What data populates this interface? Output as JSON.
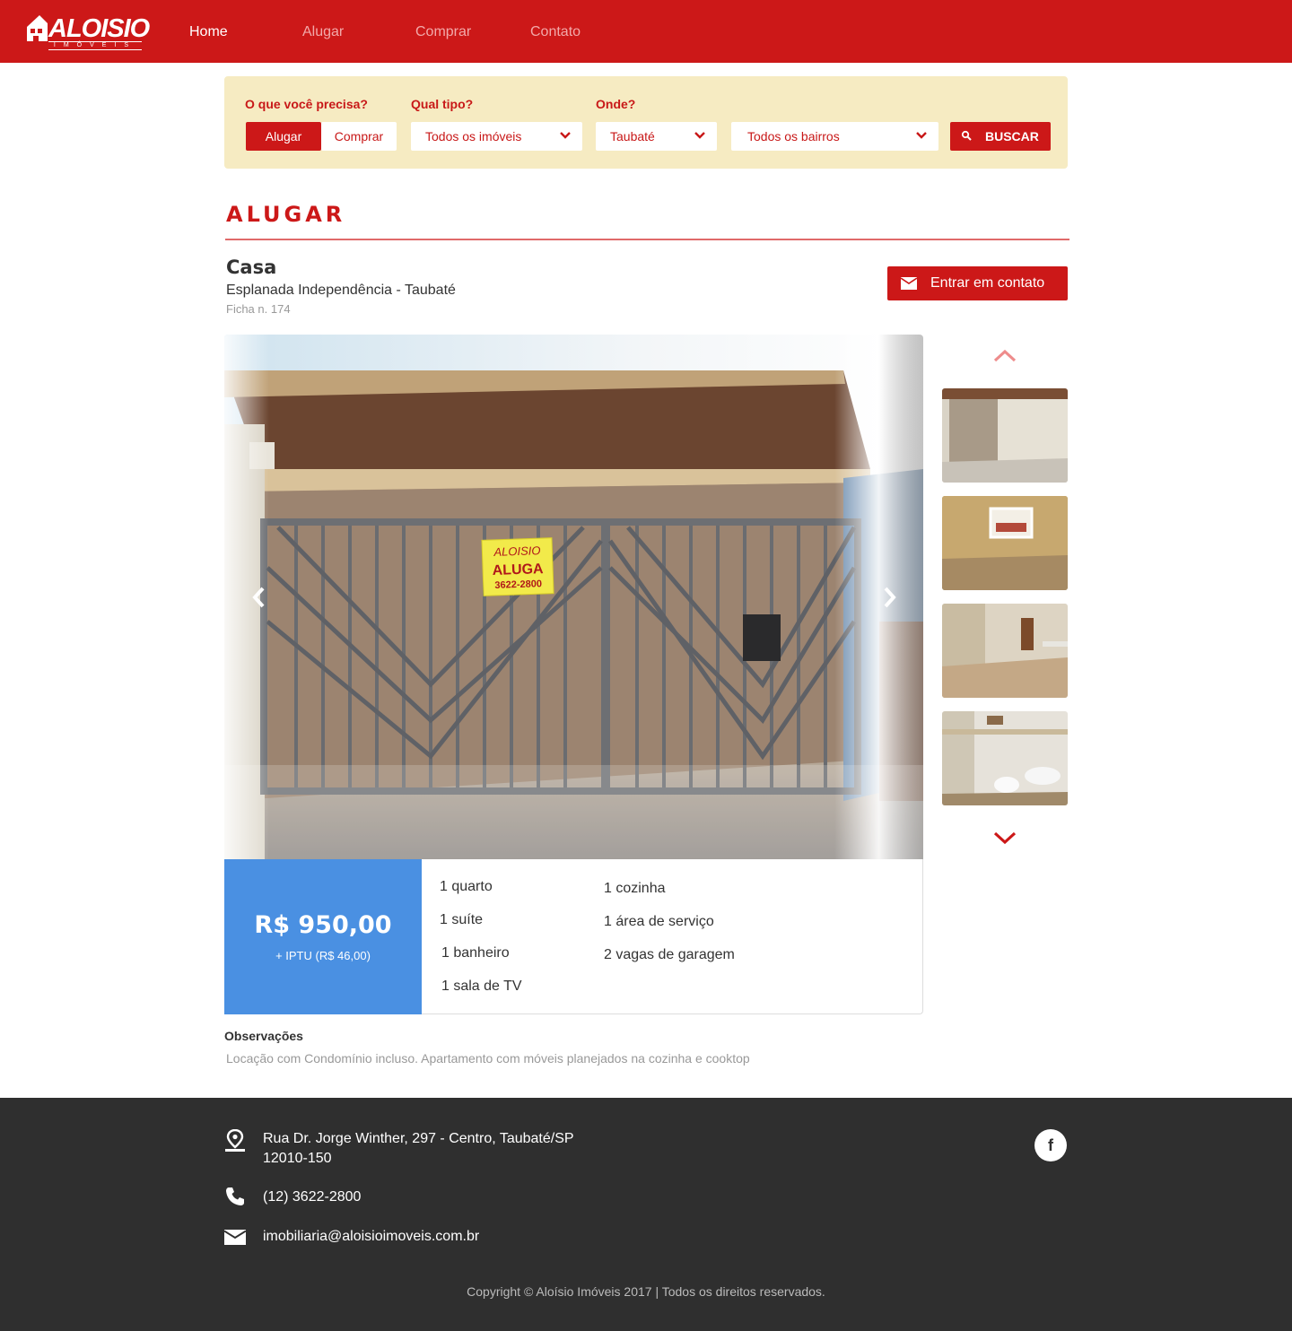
{
  "header": {
    "logo_text": "ALOISIO",
    "logo_sub": "IMÓVEIS",
    "nav": [
      "Home",
      "Alugar",
      "Comprar",
      "Contato"
    ],
    "brand_color": "#cc1818"
  },
  "search": {
    "need_label": "O que você precisa?",
    "need_options": [
      "Alugar",
      "Comprar"
    ],
    "need_selected": "Alugar",
    "type_label": "Qual tipo?",
    "type_value": "Todos os imóveis",
    "where_label": "Onde?",
    "city_value": "Taubaté",
    "district_value": "Todos os bairros",
    "button_label": "BUSCAR",
    "panel_color": "#f6ebc2"
  },
  "section": {
    "title": "ALUGAR"
  },
  "listing": {
    "type": "Casa",
    "location": "Esplanada Independência - Taubaté",
    "ref": "Ficha n. 174",
    "contact_label": "Entrar em contato",
    "photo_sign": {
      "brand": "ALOISIO",
      "word": "ALUGA",
      "phone": "3622-2800"
    },
    "thumbs_count": 4,
    "price": "R$ 950,00",
    "iptu": "+ IPTU (R$ 46,00)",
    "price_color": "#4a90e2",
    "features_left": [
      "1 quarto",
      "1 suíte",
      "1 banheiro",
      "1 sala de TV"
    ],
    "features_right": [
      "1 cozinha",
      "1 área de serviço",
      "2 vagas de garagem"
    ],
    "obs_title": "Observações",
    "obs_text": "Locação com Condomínio incluso. Apartamento com móveis planejados na cozinha e cooktop"
  },
  "footer": {
    "address_line1": "Rua Dr. Jorge Winther, 297 - Centro, Taubaté/SP",
    "address_line2": "12010-150",
    "phone": "(12) 3622-2800",
    "email": "imobiliaria@aloisioimoveis.com.br",
    "facebook": "f",
    "copyright": "Copyright © Aloísio Imóveis 2017 | Todos os direitos reservados."
  }
}
